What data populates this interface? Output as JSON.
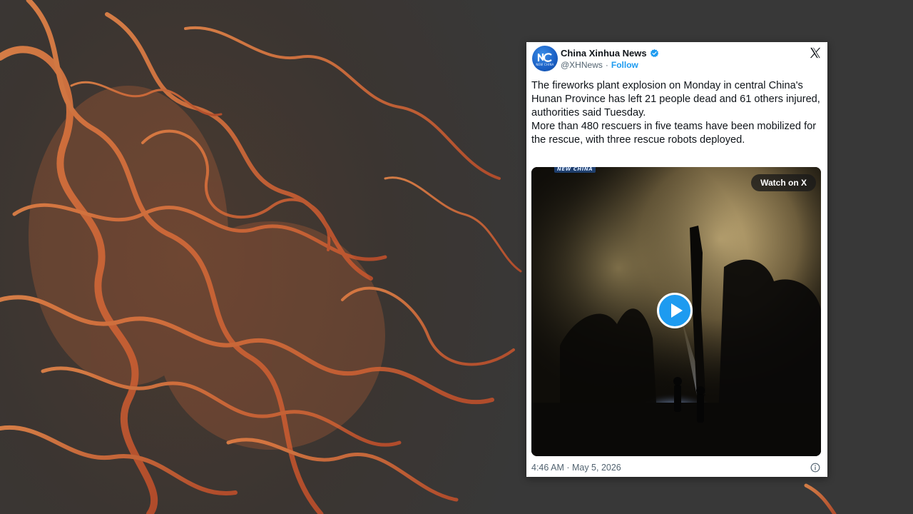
{
  "tweet": {
    "display_name": "China Xinhua News",
    "handle": "@XHNews",
    "separator": "·",
    "follow_label": "Follow",
    "avatar_text": "NEW CHINA",
    "text": "The fireworks plant explosion on Monday in central China's Hunan Province has left 21 people dead and 61 others injured, authorities said Tuesday.\nMore than 480 rescuers in five teams have been mobilized for the rescue, with three rescue robots deployed.",
    "media": {
      "watermark": "NEW CHINA",
      "watch_label": "Watch on X"
    },
    "timestamp": "4:46 AM · May 5, 2026"
  },
  "colors": {
    "accent": "#1d9bf0",
    "text": "#0f1419",
    "muted": "#536471",
    "flame": "#e5703a"
  },
  "icons": {
    "verified": "verified-badge-icon",
    "x_logo": "x-logo-icon",
    "play": "play-icon",
    "info": "info-icon"
  }
}
